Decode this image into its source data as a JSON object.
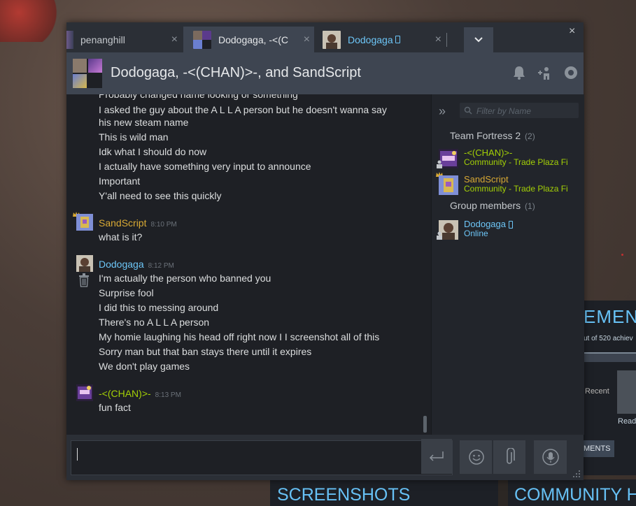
{
  "tabs": [
    {
      "label": "penanghill",
      "close": "×"
    },
    {
      "label": "Dodogaga, -<(C",
      "close": "×"
    },
    {
      "label": "Dodogaga",
      "close": "×"
    }
  ],
  "window": {
    "close": "×",
    "dropdown": "⌄"
  },
  "header": {
    "title": "Dodogaga, -<(CHAN)>-, and SandScript"
  },
  "messages": {
    "clipped": "Probably changed name looking or something",
    "block1": [
      "I asked the guy about the A L L A person but he doesn't wanna say",
      "his new steam name",
      "This is wild man",
      "Idk what I should do now",
      "I actually have something very input to announce",
      "Important",
      "Y'all need to see this quickly"
    ],
    "sand": {
      "name": "SandScript",
      "time": "8:10 PM",
      "lines": [
        "what is it?"
      ]
    },
    "dodo": {
      "name": "Dodogaga",
      "time": "8:12 PM",
      "lines": [
        "I'm actually the person who banned you",
        "Surprise fool",
        "I did this to messing around",
        "There's no A L L A person",
        "My homie laughing his head off right now I I screenshot all of this",
        "Sorry man but that ban stays there until it expires",
        "We don't play games"
      ]
    },
    "chan": {
      "name": "-<(CHAN)>-",
      "time": "8:13 PM",
      "lines": [
        "fun fact"
      ]
    }
  },
  "members": {
    "filter_placeholder": "Filter by Name",
    "groups": [
      {
        "label": "Team Fortress 2",
        "count": "(2)"
      },
      {
        "label": "Group members",
        "count": "(1)"
      }
    ],
    "list": [
      {
        "name": "-<(CHAN)>-",
        "status": "Community - Trade Plaza Fi"
      },
      {
        "name": "SandScript",
        "status": "Community - Trade Plaza Fi"
      },
      {
        "name": "Dodogaga",
        "status": "Online"
      }
    ]
  },
  "background": {
    "panel_title": "EMENT",
    "panel_sub": "ut of 520 achiev",
    "recent": "Recent",
    "read": "Read",
    "ments_button": "MENTS",
    "screenshots": "SCREENSHOTS",
    "community": "COMMUNITY H"
  },
  "colors": {
    "ingame_green": "#a3cf06",
    "online_blue": "#6dc6f7",
    "gold": "#d8a934",
    "bg": "#1e2025"
  }
}
